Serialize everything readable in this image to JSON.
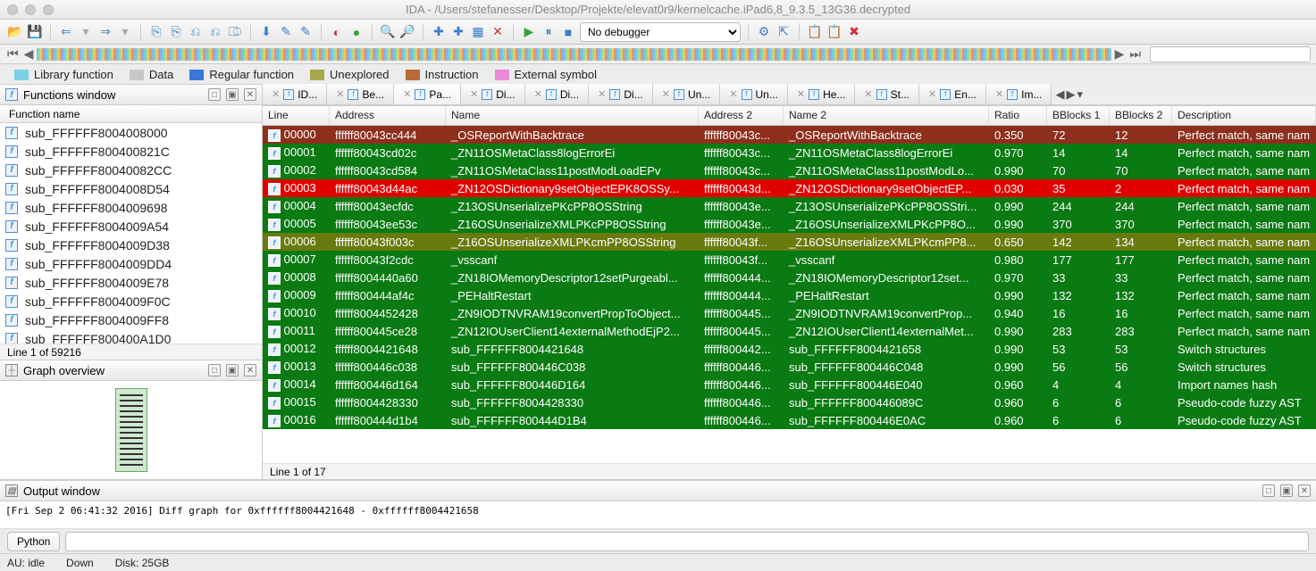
{
  "window": {
    "title": "IDA - /Users/stefanesser/Desktop/Projekte/elevat0r9/kernelcache.iPad6,8_9.3.5_13G36.decrypted"
  },
  "debugger_select": {
    "value": "No debugger"
  },
  "legend": {
    "library": "Library function",
    "data": "Data",
    "regular": "Regular function",
    "unexplored": "Unexplored",
    "instruction": "Instruction",
    "external": "External symbol"
  },
  "functions_panel": {
    "title": "Functions window",
    "column": "Function name",
    "items": [
      "sub_FFFFFF8004008000",
      "sub_FFFFFF800400821C",
      "sub_FFFFFF80040082CC",
      "sub_FFFFFF8004008D54",
      "sub_FFFFFF8004009698",
      "sub_FFFFFF8004009A54",
      "sub_FFFFFF8004009D38",
      "sub_FFFFFF8004009DD4",
      "sub_FFFFFF8004009E78",
      "sub_FFFFFF8004009F0C",
      "sub_FFFFFF8004009FF8",
      "sub_FFFFFF800400A1D0"
    ],
    "status": "Line 1 of 59216"
  },
  "graph_panel": {
    "title": "Graph overview"
  },
  "tabs": {
    "items": [
      "ID...",
      "Be...",
      "Pa...",
      "Di...",
      "Di...",
      "Di...",
      "Un...",
      "Un...",
      "He...",
      "St...",
      "En...",
      "Im..."
    ],
    "active_index": 2
  },
  "grid": {
    "columns": [
      "Line",
      "Address",
      "Name",
      "Address 2",
      "Name 2",
      "Ratio",
      "BBlocks 1",
      "BBlocks 2",
      "Description"
    ],
    "rows": [
      {
        "cls": "row-darkred",
        "line": "00000",
        "addr": "ffffff80043cc444",
        "name": "_OSReportWithBacktrace",
        "addr2": "ffffff80043c...",
        "name2": "_OSReportWithBacktrace",
        "ratio": "0.350",
        "bb1": "72",
        "bb2": "12",
        "desc": "Perfect match, same nam"
      },
      {
        "cls": "row-green",
        "line": "00001",
        "addr": "ffffff80043cd02c",
        "name": "_ZN11OSMetaClass8logErrorEi",
        "addr2": "ffffff80043c...",
        "name2": "_ZN11OSMetaClass8logErrorEi",
        "ratio": "0.970",
        "bb1": "14",
        "bb2": "14",
        "desc": "Perfect match, same nam"
      },
      {
        "cls": "row-green",
        "line": "00002",
        "addr": "ffffff80043cd584",
        "name": "_ZN11OSMetaClass11postModLoadEPv",
        "addr2": "ffffff80043c...",
        "name2": "_ZN11OSMetaClass11postModLo...",
        "ratio": "0.990",
        "bb1": "70",
        "bb2": "70",
        "desc": "Perfect match, same nam"
      },
      {
        "cls": "row-red",
        "line": "00003",
        "addr": "ffffff80043d44ac",
        "name": "_ZN12OSDictionary9setObjectEPK8OSSy...",
        "addr2": "ffffff80043d...",
        "name2": "_ZN12OSDictionary9setObjectEP...",
        "ratio": "0.030",
        "bb1": "35",
        "bb2": "2",
        "desc": "Perfect match, same nam"
      },
      {
        "cls": "row-green",
        "line": "00004",
        "addr": "ffffff80043ecfdc",
        "name": "_Z13OSUnserializePKcPP8OSString",
        "addr2": "ffffff80043e...",
        "name2": "_Z13OSUnserializePKcPP8OSStri...",
        "ratio": "0.990",
        "bb1": "244",
        "bb2": "244",
        "desc": "Perfect match, same nam"
      },
      {
        "cls": "row-green",
        "line": "00005",
        "addr": "ffffff80043ee53c",
        "name": "_Z16OSUnserializeXMLPKcPP8OSString",
        "addr2": "ffffff80043e...",
        "name2": "_Z16OSUnserializeXMLPKcPP8O...",
        "ratio": "0.990",
        "bb1": "370",
        "bb2": "370",
        "desc": "Perfect match, same nam"
      },
      {
        "cls": "row-olive",
        "line": "00006",
        "addr": "ffffff80043f003c",
        "name": "_Z16OSUnserializeXMLPKcmPP8OSString",
        "addr2": "ffffff80043f...",
        "name2": "_Z16OSUnserializeXMLPKcmPP8...",
        "ratio": "0.650",
        "bb1": "142",
        "bb2": "134",
        "desc": "Perfect match, same nam"
      },
      {
        "cls": "row-green",
        "line": "00007",
        "addr": "ffffff80043f2cdc",
        "name": "_vsscanf",
        "addr2": "ffffff80043f...",
        "name2": "_vsscanf",
        "ratio": "0.980",
        "bb1": "177",
        "bb2": "177",
        "desc": "Perfect match, same nam"
      },
      {
        "cls": "row-green",
        "line": "00008",
        "addr": "ffffff8004440a60",
        "name": "_ZN18IOMemoryDescriptor12setPurgeabl...",
        "addr2": "ffffff800444...",
        "name2": "_ZN18IOMemoryDescriptor12set...",
        "ratio": "0.970",
        "bb1": "33",
        "bb2": "33",
        "desc": "Perfect match, same nam"
      },
      {
        "cls": "row-green",
        "line": "00009",
        "addr": "ffffff800444af4c",
        "name": "_PEHaltRestart",
        "addr2": "ffffff800444...",
        "name2": "_PEHaltRestart",
        "ratio": "0.990",
        "bb1": "132",
        "bb2": "132",
        "desc": "Perfect match, same nam"
      },
      {
        "cls": "row-green",
        "line": "00010",
        "addr": "ffffff8004452428",
        "name": "_ZN9IODTNVRAM19convertPropToObject...",
        "addr2": "ffffff800445...",
        "name2": "_ZN9IODTNVRAM19convertProp...",
        "ratio": "0.940",
        "bb1": "16",
        "bb2": "16",
        "desc": "Perfect match, same nam"
      },
      {
        "cls": "row-green",
        "line": "00011",
        "addr": "ffffff800445ce28",
        "name": "_ZN12IOUserClient14externalMethodEjP2...",
        "addr2": "ffffff800445...",
        "name2": "_ZN12IOUserClient14externalMet...",
        "ratio": "0.990",
        "bb1": "283",
        "bb2": "283",
        "desc": "Perfect match, same nam"
      },
      {
        "cls": "row-green",
        "line": "00012",
        "addr": "ffffff8004421648",
        "name": "sub_FFFFFF8004421648",
        "addr2": "ffffff800442...",
        "name2": "sub_FFFFFF8004421658",
        "ratio": "0.990",
        "bb1": "53",
        "bb2": "53",
        "desc": "Switch structures"
      },
      {
        "cls": "row-green",
        "line": "00013",
        "addr": "ffffff800446c038",
        "name": "sub_FFFFFF800446C038",
        "addr2": "ffffff800446...",
        "name2": "sub_FFFFFF800446C048",
        "ratio": "0.990",
        "bb1": "56",
        "bb2": "56",
        "desc": "Switch structures"
      },
      {
        "cls": "row-green",
        "line": "00014",
        "addr": "ffffff800446d164",
        "name": "sub_FFFFFF800446D164",
        "addr2": "ffffff800446...",
        "name2": "sub_FFFFFF800446E040",
        "ratio": "0.960",
        "bb1": "4",
        "bb2": "4",
        "desc": "Import names hash"
      },
      {
        "cls": "row-green",
        "line": "00015",
        "addr": "ffffff8004428330",
        "name": "sub_FFFFFF8004428330",
        "addr2": "ffffff800446...",
        "name2": "sub_FFFFFF800446089C",
        "ratio": "0.960",
        "bb1": "6",
        "bb2": "6",
        "desc": "Pseudo-code fuzzy AST"
      },
      {
        "cls": "row-green",
        "line": "00016",
        "addr": "ffffff800444d1b4",
        "name": "sub_FFFFFF800444D1B4",
        "addr2": "ffffff800446...",
        "name2": "sub_FFFFFF800446E0AC",
        "ratio": "0.960",
        "bb1": "6",
        "bb2": "6",
        "desc": "Pseudo-code fuzzy AST"
      }
    ],
    "status": "Line 1 of 17"
  },
  "output": {
    "title": "Output window",
    "text": "[Fri Sep  2 06:41:32 2016] Diff graph for 0xffffff8004421648 - 0xffffff8004421658",
    "button": "Python"
  },
  "footer": {
    "au": "AU:  idle",
    "down": "Down",
    "disk": "Disk: 25GB"
  }
}
